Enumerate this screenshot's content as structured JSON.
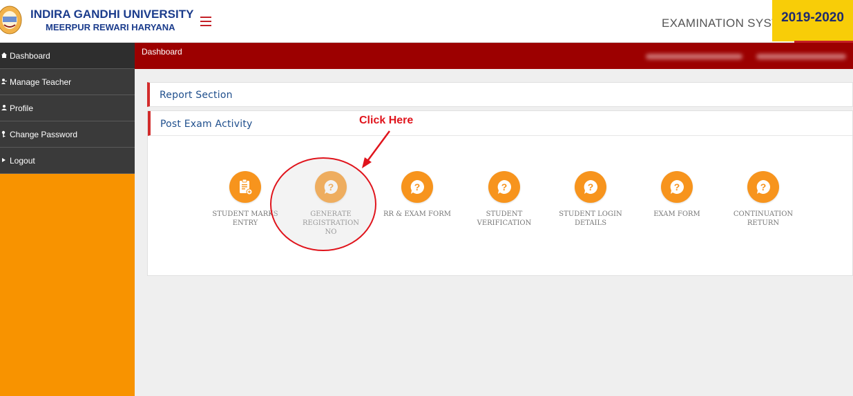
{
  "header": {
    "university_name": "INDIRA GANDHI UNIVERSITY",
    "university_location": "MEERPUR REWARI HARYANA",
    "system_title": "EXAMINATION SYSTEM",
    "session": "2019-2020"
  },
  "sidebar": {
    "items": [
      {
        "label": "Dashboard",
        "icon": "home-icon"
      },
      {
        "label": "Manage Teacher",
        "icon": "users-icon"
      },
      {
        "label": "Profile",
        "icon": "user-icon"
      },
      {
        "label": "Change Password",
        "icon": "key-icon"
      },
      {
        "label": "Logout",
        "icon": "logout-icon"
      }
    ]
  },
  "topbar": {
    "breadcrumb": "Dashboard"
  },
  "sections": {
    "report": "Report Section",
    "post_exam": "Post Exam Activity"
  },
  "tiles": [
    {
      "label": "STUDENT MARKS ENTRY",
      "icon": "clipboard-icon"
    },
    {
      "label": "GENERATE REGISTRATION NO",
      "icon": "question-bubble-icon"
    },
    {
      "label": "RR & EXAM FORM",
      "icon": "question-bubble-icon"
    },
    {
      "label": "STUDENT VERIFICATION",
      "icon": "question-bubble-icon"
    },
    {
      "label": "STUDENT LOGIN DETAILS",
      "icon": "question-bubble-icon"
    },
    {
      "label": "EXAM FORM",
      "icon": "question-bubble-icon"
    },
    {
      "label": "CONTINUATION RETURN",
      "icon": "question-bubble-icon"
    }
  ],
  "annotation": {
    "text": "Click Here"
  },
  "colors": {
    "accent_orange": "#f7941d",
    "topbar_red": "#9c0000",
    "session_yellow": "#f8cd08",
    "annotation_red": "#e0141c"
  }
}
